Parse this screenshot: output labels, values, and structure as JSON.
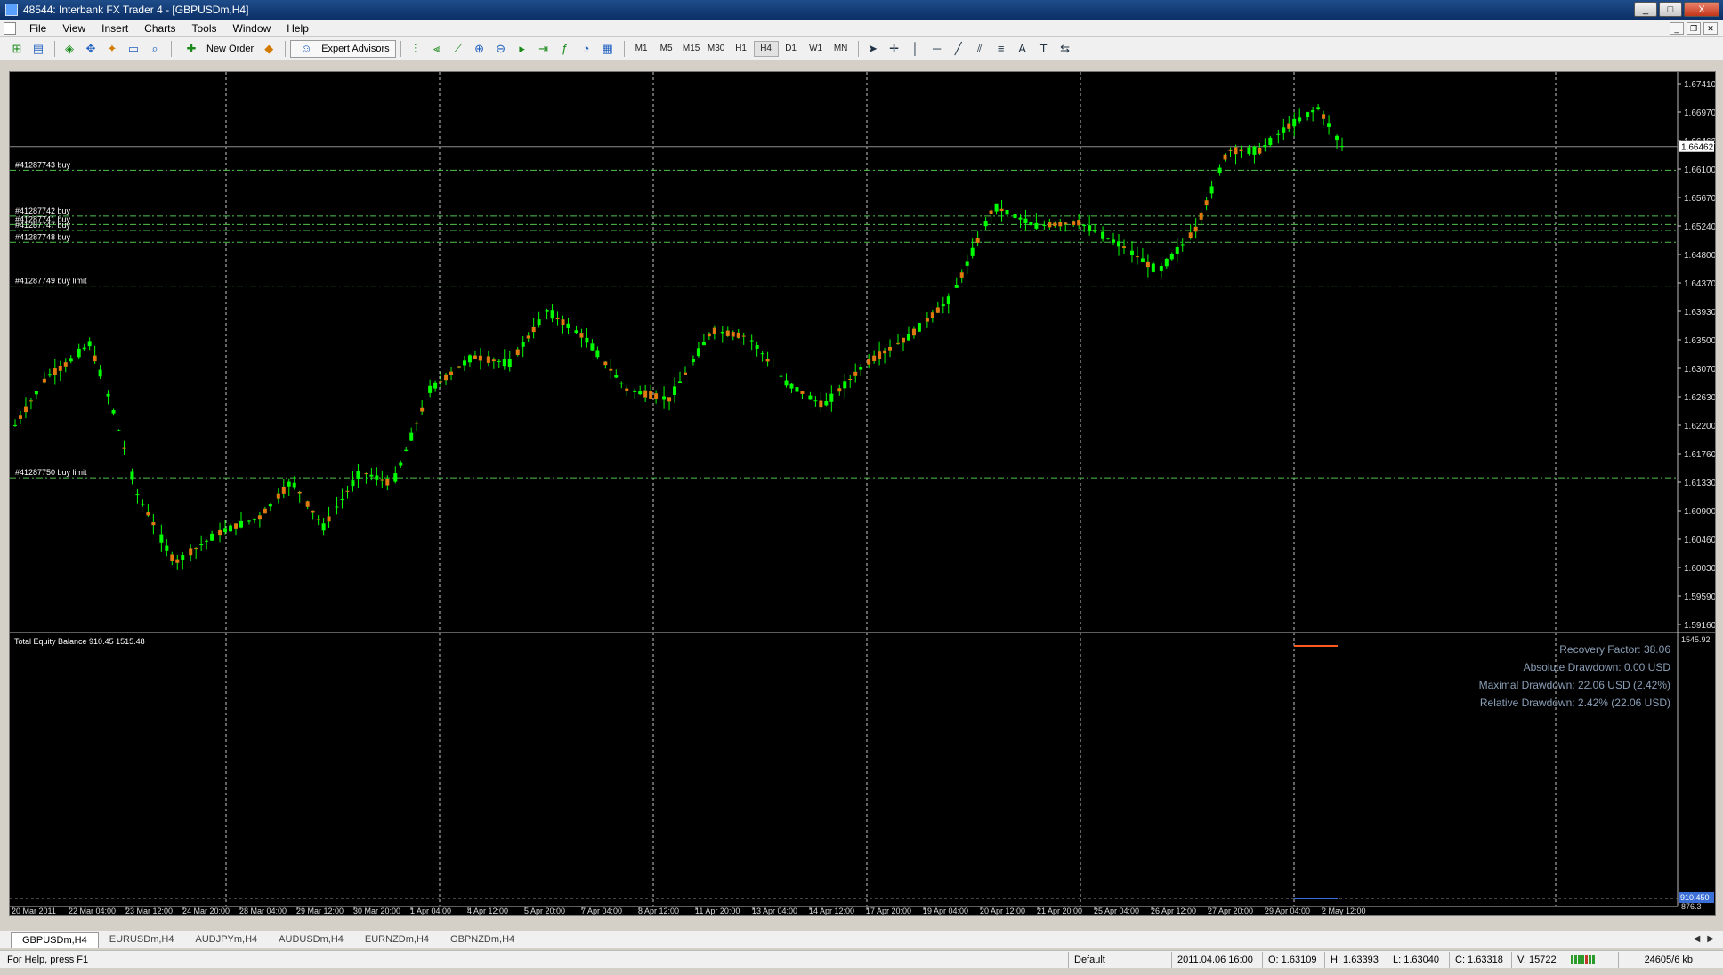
{
  "window": {
    "title": "48544: Interbank FX Trader 4 - [GBPUSDm,H4]",
    "buttons": [
      "_",
      "□",
      "X"
    ]
  },
  "menu": [
    "File",
    "View",
    "Insert",
    "Charts",
    "Tools",
    "Window",
    "Help"
  ],
  "toolbar": {
    "new_order": "New Order",
    "expert_advisors": "Expert Advisors",
    "timeframes": [
      "M1",
      "M5",
      "M15",
      "M30",
      "H1",
      "H4",
      "D1",
      "W1",
      "MN"
    ],
    "active_timeframe": "H4"
  },
  "chart": {
    "price_labels": [
      "1.67410",
      "1.66970",
      "1.66462",
      "1.66100",
      "1.65670",
      "1.65240",
      "1.64800",
      "1.64370",
      "1.63930",
      "1.63500",
      "1.63070",
      "1.62630",
      "1.62200",
      "1.61760",
      "1.61330",
      "1.60900",
      "1.60460",
      "1.60030",
      "1.59590",
      "1.59160"
    ],
    "current_price": "1.66462",
    "time_labels": [
      "20 Mar 2011",
      "22 Mar 04:00",
      "23 Mar 12:00",
      "24 Mar 20:00",
      "28 Mar 04:00",
      "29 Mar 12:00",
      "30 Mar 20:00",
      "1 Apr 04:00",
      "4 Apr 12:00",
      "5 Apr 20:00",
      "7 Apr 04:00",
      "8 Apr 12:00",
      "11 Apr 20:00",
      "13 Apr 04:00",
      "14 Apr 12:00",
      "17 Apr 20:00",
      "19 Apr 04:00",
      "20 Apr 12:00",
      "21 Apr 20:00",
      "25 Apr 04:00",
      "26 Apr 12:00",
      "27 Apr 20:00",
      "29 Apr 04:00",
      "2 May 12:00"
    ],
    "orders": [
      {
        "label": "#41287743 buy",
        "price": 1.661
      },
      {
        "label": "#41287742 buy",
        "price": 1.654
      },
      {
        "label": "#41287741 buy",
        "price": 1.6527
      },
      {
        "label": "#41287747 buy",
        "price": 1.6518
      },
      {
        "label": "#41287748 buy",
        "price": 1.65
      },
      {
        "label": "#41287749 buy limit",
        "price": 1.6433
      },
      {
        "label": "#41287750 buy limit",
        "price": 1.614
      }
    ],
    "colors": {
      "bull": "#00ff00",
      "bear": "#e07a10",
      "wick": "#00ff00",
      "grid": "#ffffff",
      "order_line": "#4ec24e"
    }
  },
  "indicator": {
    "title": "Total Equity Balance 910.45 1515.48",
    "scale_top": "1545.92",
    "scale_mid": "910.450",
    "scale_bottom": "876.3",
    "stats": [
      "Recovery Factor: 38.06",
      "Absolute Drawdown: 0.00 USD",
      "Maximal Drawdown: 22.06 USD (2.42%)",
      "Relative Drawdown: 2.42% (22.06 USD)"
    ]
  },
  "tabs": [
    "GBPUSDm,H4",
    "EURUSDm,H4",
    "AUDJPYm,H4",
    "AUDUSDm,H4",
    "EURNZDm,H4",
    "GBPNZDm,H4"
  ],
  "status": {
    "help": "For Help, press F1",
    "profile": "Default",
    "time": "2011.04.06 16:00",
    "open": "O: 1.63109",
    "high": "H: 1.63393",
    "low": "L: 1.63040",
    "close": "C: 1.63318",
    "volume": "V: 15722",
    "traffic": "24605/6 kb"
  }
}
